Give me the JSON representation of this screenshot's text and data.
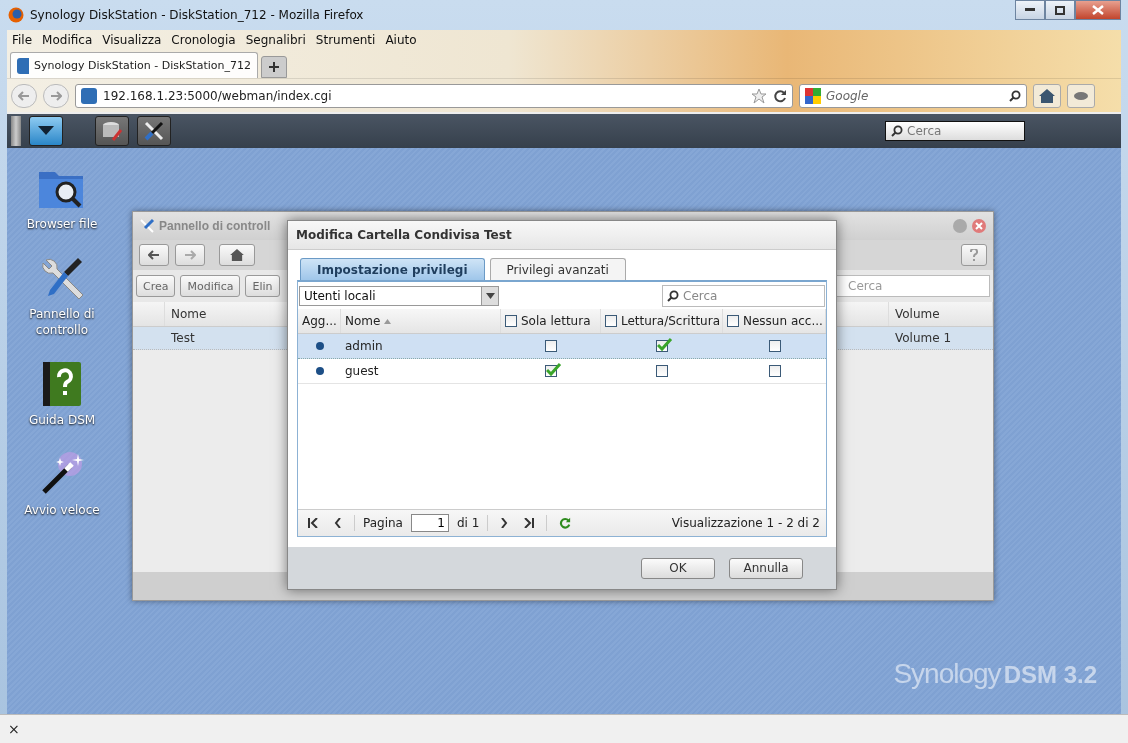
{
  "browser": {
    "title": "Synology DiskStation - DiskStation_712 - Mozilla Firefox",
    "menu": [
      "File",
      "Modifica",
      "Visualizza",
      "Cronologia",
      "Segnalibri",
      "Strumenti",
      "Aiuto"
    ],
    "tab": {
      "title": "Synology DiskStation - DiskStation_712"
    },
    "url": "192.168.1.23:5000/webman/index.cgi",
    "search_placeholder": "Google"
  },
  "taskbar": {
    "search_placeholder": "Cerca"
  },
  "desktop_icons": [
    {
      "label": "Browser file",
      "kind": "files"
    },
    {
      "label": "Pannello di controllo",
      "kind": "tools"
    },
    {
      "label": "Guida DSM",
      "kind": "help"
    },
    {
      "label": "Avvio veloce",
      "kind": "wand"
    }
  ],
  "logo": {
    "brand": "Synology",
    "product": "DSM 3.2"
  },
  "control_panel": {
    "title": "Pannello di controll",
    "toolbar": [
      "Crea",
      "Modifica",
      "Elin"
    ],
    "search_placeholder": "Cerca",
    "columns": [
      "Nome",
      "Volume"
    ],
    "rows": [
      {
        "name": "Test",
        "volume": "Volume 1",
        "selected": true
      }
    ]
  },
  "dialog": {
    "title": "Modifica Cartella Condivisa Test",
    "tabs": [
      {
        "label": "Impostazione privilegi",
        "selected": true
      },
      {
        "label": "Privilegi avanzati",
        "selected": false
      }
    ],
    "filter": "Utenti locali",
    "search_placeholder": "Cerca",
    "columns": [
      {
        "label": "Agg...",
        "kind": "plain"
      },
      {
        "label": "Nome",
        "kind": "sort"
      },
      {
        "label": "Sola lettura",
        "kind": "check",
        "checked": false
      },
      {
        "label": "Lettura/Scrittura",
        "kind": "check",
        "checked": false
      },
      {
        "label": "Nessun acc...",
        "kind": "check",
        "checked": false
      }
    ],
    "rows": [
      {
        "name": "admin",
        "selected": true,
        "access": [
          false,
          true,
          false
        ]
      },
      {
        "name": "guest",
        "selected": false,
        "access": [
          true,
          false,
          false
        ]
      }
    ],
    "pager": {
      "page_label": "Pagina",
      "page": "1",
      "of": "di 1",
      "summary": "Visualizzazione 1 - 2 di 2"
    },
    "buttons": [
      "OK",
      "Annulla"
    ]
  },
  "status_bar": {
    "close": "×"
  }
}
